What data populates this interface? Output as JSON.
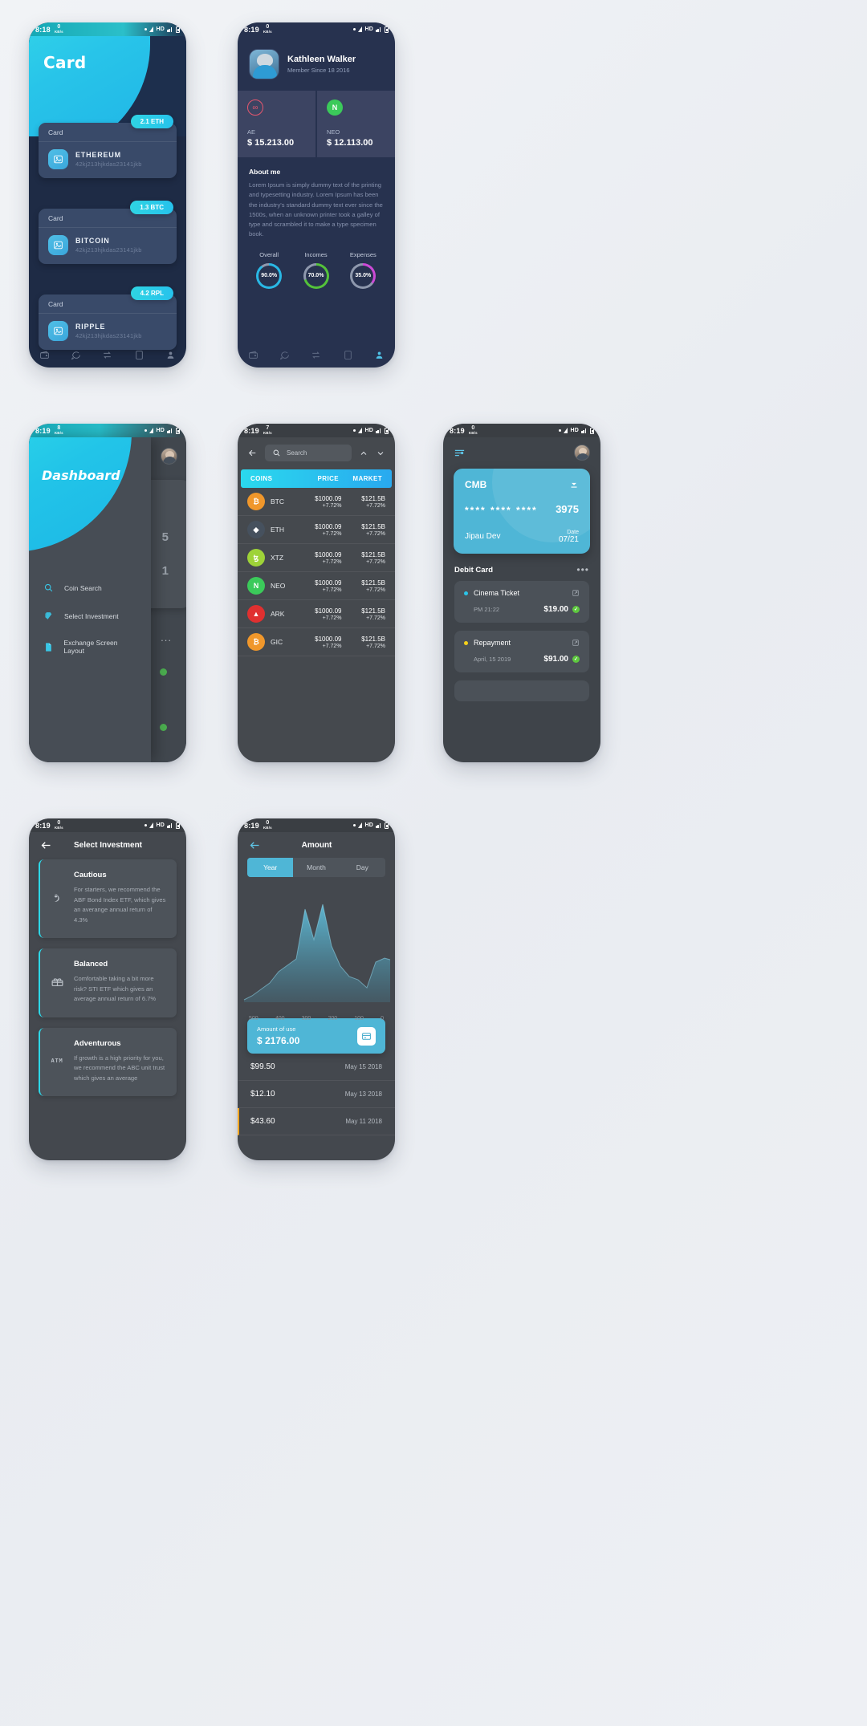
{
  "phones": {
    "card": {
      "status": {
        "time": "8:18",
        "kb": "0",
        "kbunit": "KB/s",
        "hd": "HD"
      },
      "title": "Card",
      "cards": [
        {
          "badge": "2.1 ETH",
          "label": "Card",
          "name": "ETHEREUM",
          "hash": "42kj213hjkdas23141jkb"
        },
        {
          "badge": "1.3 BTC",
          "label": "Card",
          "name": "BITCOIN",
          "hash": "42kj213hjkdas23141jkb"
        },
        {
          "badge": "4.2 RPL",
          "label": "Card",
          "name": "RIPPLE",
          "hash": "42kj213hjkdas23141jkb"
        }
      ],
      "nav": [
        "wallet-icon",
        "chat-icon",
        "exchange-icon",
        "cards-icon",
        "person-icon"
      ]
    },
    "profile": {
      "status": {
        "time": "8:19",
        "kb": "0",
        "kbunit": "KB/s",
        "hd": "HD"
      },
      "name": "Kathleen Walker",
      "member_since": "Member Since 18 2016",
      "wallets": [
        {
          "ticker": "AE",
          "amount": "$ 15.213.00",
          "color": "#e8576f"
        },
        {
          "ticker": "NEO",
          "amount": "$ 12.113.00",
          "color": "#3bca5a"
        }
      ],
      "about_title": "About me",
      "about_text": "Lorem Ipsum is simply dummy text of the printing and typesetting industry. Lorem Ipsum has been the industry's standard dummy text ever since the 1500s, when an unknown printer took a galley of type and scrambled it to make a type specimen book.",
      "stats": [
        {
          "label": "Overall",
          "value": "90.0%",
          "pct": 90,
          "color": "#29b8e5"
        },
        {
          "label": "Incomes",
          "value": "70.0%",
          "pct": 70,
          "color": "#54c23a"
        },
        {
          "label": "Expenses",
          "value": "35.0%",
          "pct": 35,
          "color": "#cc4ad6"
        }
      ]
    },
    "dashboard": {
      "status": {
        "time": "8:19",
        "kb": "8",
        "kbunit": "KB/s",
        "hd": "HD"
      },
      "title": "Dashboard",
      "menu": [
        {
          "label": "Coin Search",
          "icon": "search-icon"
        },
        {
          "label": "Select Investment",
          "icon": "cards-stack-icon"
        },
        {
          "label": "Exchange Screen Layout",
          "icon": "document-icon"
        }
      ],
      "behind": {
        "n1": "5",
        "n2": "1",
        "dots": "..."
      }
    },
    "market": {
      "status": {
        "time": "8:19",
        "kb": "7",
        "kbunit": "KB/s",
        "hd": "HD"
      },
      "search_placeholder": "Search",
      "columns": [
        "COINS",
        "PRICE",
        "MARKET"
      ],
      "rows": [
        {
          "sym": "BTC",
          "color": "#f0972b",
          "price": "$1000.09",
          "price_chg": "+7.72%",
          "market": "$121.5B",
          "market_chg": "+7.72%"
        },
        {
          "sym": "ETH",
          "color": "#46515e",
          "price": "$1000.09",
          "price_chg": "+7.72%",
          "market": "$121.5B",
          "market_chg": "+7.72%"
        },
        {
          "sym": "XTZ",
          "color": "#9ed338",
          "price": "$1000.09",
          "price_chg": "+7.72%",
          "market": "$121.5B",
          "market_chg": "+7.72%"
        },
        {
          "sym": "NEO",
          "color": "#3bca5a",
          "price": "$1000.09",
          "price_chg": "+7.72%",
          "market": "$121.5B",
          "market_chg": "+7.72%"
        },
        {
          "sym": "ARK",
          "color": "#e03030",
          "price": "$1000.09",
          "price_chg": "+7.72%",
          "market": "$121.5B",
          "market_chg": "+7.72%"
        },
        {
          "sym": "GIC",
          "color": "#f0972b",
          "price": "$1000.09",
          "price_chg": "+7.72%",
          "market": "$121.5B",
          "market_chg": "+7.72%"
        }
      ]
    },
    "debit": {
      "status": {
        "time": "8:19",
        "kb": "0",
        "kbunit": "KB/s",
        "hd": "HD"
      },
      "card": {
        "bank": "CMB",
        "stars": "****  ****  ****",
        "last4": "3975",
        "holder": "Jipau Dev",
        "date_label": "Date",
        "date_value": "07/21"
      },
      "section_title": "Debit Card",
      "section_more": "•••",
      "transactions": [
        {
          "name": "Cinema Ticket",
          "time": "PM 21:22",
          "amount": "$19.00",
          "dot": "#2bc4e8"
        },
        {
          "name": "Repayment",
          "time": "April, 15 2019",
          "amount": "$91.00",
          "dot": "#f5d11a"
        }
      ]
    },
    "invest": {
      "status": {
        "time": "8:19",
        "kb": "0",
        "kbunit": "KB/s",
        "hd": "HD"
      },
      "title": "Select Investment",
      "options": [
        {
          "name": "Cautious",
          "icon": "ribbon-icon",
          "desc": "For starters, we recommend the ABF Bond Index ETF, which gives an averange annual return of 4.3%"
        },
        {
          "name": "Balanced",
          "icon": "gift-icon",
          "desc": "Comfortable taking a bit more risk? STI ETF which gives an average annual return of 6.7%"
        },
        {
          "name": "Adventurous",
          "icon": "atm-icon",
          "desc": "If growth is a high priority for you, we recommend the ABC unit trust which gives an average"
        }
      ]
    },
    "amount": {
      "status": {
        "time": "8:19",
        "kb": "0",
        "kbunit": "KB/s",
        "hd": "HD"
      },
      "title": "Amount",
      "tabs": [
        {
          "label": "Year",
          "active": true
        },
        {
          "label": "Month",
          "active": false
        },
        {
          "label": "Day",
          "active": false
        }
      ],
      "summary": {
        "label": "Amount of use",
        "value": "$ 2176.00",
        "icon": "card-icon"
      },
      "history": [
        {
          "amount": "$99.50",
          "date": "May 15 2018"
        },
        {
          "amount": "$12.10",
          "date": "May 13 2018"
        },
        {
          "amount": "$43.60",
          "date": "May 11 2018"
        }
      ],
      "chart_data": {
        "type": "area",
        "title": "Amount",
        "x": [
          500,
          400,
          300,
          200,
          100,
          0
        ],
        "xlabel": "",
        "ylabel": "",
        "tick_labels": [
          "500",
          "400",
          "300",
          "200",
          "100",
          "0"
        ],
        "values": [
          8,
          14,
          22,
          30,
          45,
          52,
          60,
          96,
          70,
          100,
          62,
          40,
          30,
          26,
          18,
          42,
          46,
          44
        ],
        "ylim": [
          0,
          100
        ],
        "grid": false,
        "legend": "none",
        "series": [
          {
            "name": "usage",
            "values": [
              8,
              14,
              22,
              30,
              45,
              52,
              60,
              96,
              70,
              100,
              62,
              40,
              30,
              26,
              18,
              42,
              46,
              44
            ]
          }
        ]
      }
    }
  }
}
